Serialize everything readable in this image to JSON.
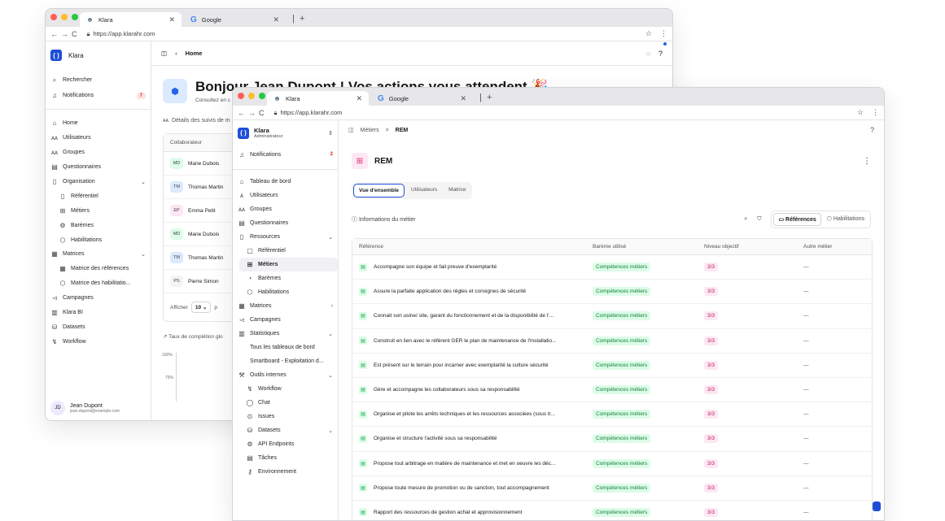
{
  "back_window": {
    "tabs": [
      {
        "title": "Klara"
      },
      {
        "title": "Google"
      }
    ],
    "url": "https://app.klarahr.com",
    "app_name": "Klara",
    "breadcrumb": "Home",
    "sidebar": {
      "top": [
        {
          "label": "Rechercher",
          "icon": "search-icon"
        },
        {
          "label": "Notifications",
          "icon": "bell-icon",
          "badge": "7"
        }
      ],
      "items": [
        {
          "label": "Home",
          "icon": "home-icon"
        },
        {
          "label": "Utilisateurs",
          "icon": "users-icon"
        },
        {
          "label": "Groupes",
          "icon": "group-icon"
        },
        {
          "label": "Questionnaires",
          "icon": "clipboard-icon"
        },
        {
          "label": "Organisation",
          "icon": "book-icon",
          "chevron": "⌄"
        },
        {
          "label": "Référentiel",
          "icon": "book-icon",
          "sub": true
        },
        {
          "label": "Métiers",
          "icon": "briefcase-icon",
          "sub": true
        },
        {
          "label": "Barèmes",
          "icon": "gear-icon",
          "sub": true
        },
        {
          "label": "Habilitations",
          "icon": "shield-icon",
          "sub": true
        },
        {
          "label": "Matrices",
          "icon": "grid-icon",
          "chevron": "⌄"
        },
        {
          "label": "Matrice des références",
          "icon": "grid-icon",
          "sub": true
        },
        {
          "label": "Matrice des habilitatio...",
          "icon": "shield-icon",
          "sub": true
        },
        {
          "label": "Campagnes",
          "icon": "megaphone-icon"
        },
        {
          "label": "Klara BI",
          "icon": "chart-icon"
        },
        {
          "label": "Datasets",
          "icon": "database-icon"
        },
        {
          "label": "Workflow",
          "icon": "workflow-icon"
        }
      ],
      "user": {
        "initials": "JD",
        "name": "Jean Dupont",
        "email": "jean.dupont@example.com"
      }
    },
    "greeting": "Bonjour Jean Dupont ! Vos actions vous attendent 🎉",
    "greeting_sub": "Consultez en c",
    "followups_title": "Détails des suivis de m",
    "table_header": "Collaborateur",
    "people": [
      {
        "initials": "MD",
        "name": "Marie Dubois",
        "color": "#dcfce7"
      },
      {
        "initials": "TM",
        "name": "Thomas Martin",
        "color": "#dbeafe"
      },
      {
        "initials": "EP",
        "name": "Emma Petit",
        "color": "#fce7f3"
      },
      {
        "initials": "MD",
        "name": "Marie Dubois",
        "color": "#dcfce7"
      },
      {
        "initials": "TM",
        "name": "Thomas Martin",
        "color": "#dbeafe"
      },
      {
        "initials": "PS",
        "name": "Pierre Simon",
        "color": "#f4f4f5"
      }
    ],
    "pager_label": "Afficher",
    "pager_value": "10",
    "pager_tail": "p",
    "completion_title": "Taux de complétion glo",
    "chart_ticks": [
      "100%",
      "75%"
    ]
  },
  "front_window": {
    "tabs": [
      {
        "title": "Klara"
      },
      {
        "title": "Google"
      }
    ],
    "url": "https://app.klarahr.com",
    "org": {
      "name": "Klara",
      "role": "Administrateur"
    },
    "notifications": {
      "label": "Notifications",
      "badge": "2"
    },
    "sidebar": [
      {
        "label": "Tableau de bord",
        "icon": "home-icon"
      },
      {
        "label": "Utilisateurs",
        "icon": "user-icon"
      },
      {
        "label": "Groupes",
        "icon": "group-icon"
      },
      {
        "label": "Questionnaires",
        "icon": "clipboard-icon"
      },
      {
        "label": "Ressources",
        "icon": "book-icon",
        "chevron": "⌄"
      },
      {
        "label": "Référentiel",
        "icon": "doc-icon",
        "sub": true
      },
      {
        "label": "Métiers",
        "icon": "briefcase-icon",
        "sub": true,
        "active": true
      },
      {
        "label": "Barèmes",
        "icon": "gauge-icon",
        "sub": true
      },
      {
        "label": "Habilitations",
        "icon": "shield-icon",
        "sub": true
      },
      {
        "label": "Matrices",
        "icon": "grid-icon",
        "chevron": "›"
      },
      {
        "label": "Campagnes",
        "icon": "megaphone-icon"
      },
      {
        "label": "Statistiques",
        "icon": "chart-icon",
        "chevron": "⌄"
      },
      {
        "label": "Tous les tableaux de bord",
        "icon": "",
        "sub": true
      },
      {
        "label": "Smartboard - Exploitation d...",
        "icon": "",
        "sub": true
      },
      {
        "label": "Outils internes",
        "icon": "wrench-icon",
        "chevron": "⌄"
      },
      {
        "label": "Workflow",
        "icon": "workflow-icon",
        "sub": true
      },
      {
        "label": "Chat",
        "icon": "chat-icon",
        "sub": true
      },
      {
        "label": "Issues",
        "icon": "issue-icon",
        "sub": true
      },
      {
        "label": "Datasets",
        "icon": "database-icon",
        "sub": true,
        "chevron": "⌄"
      },
      {
        "label": "API Endpoints",
        "icon": "gear-icon",
        "sub": true
      },
      {
        "label": "Tâches",
        "icon": "clipboard-icon",
        "sub": true
      },
      {
        "label": "Environnement",
        "icon": "key-icon",
        "sub": true
      }
    ],
    "breadcrumb": {
      "parent": "Métiers",
      "sep": ">",
      "current": "REM"
    },
    "page_title": "REM",
    "tabs_view": [
      "Vue d'ensemble",
      "Utilisateurs",
      "Matrice"
    ],
    "info_label": "Informations du métier",
    "toggle": {
      "refs": "Références",
      "habs": "Habilitations"
    },
    "columns": [
      "Référence",
      "Barème utilisé",
      "Niveau objectif",
      "Autre métier"
    ],
    "rows": [
      {
        "ref": "Accompagne son équipe et fait preuve d'exemplarité",
        "bareme": "Compétences métiers",
        "level": "3/3",
        "other": "—"
      },
      {
        "ref": "Assure la parfaite application des règles et consignes de sécurité",
        "bareme": "Compétences métiers",
        "level": "3/3",
        "other": "—"
      },
      {
        "ref": "Connait son usine/ site, garant du fonctionnement et de la disponibilité de l'...",
        "bareme": "Compétences métiers",
        "level": "3/3",
        "other": "—"
      },
      {
        "ref": "Construit en lien avec le référent GER le plan de maintenance de l'installatio...",
        "bareme": "Compétences métiers",
        "level": "3/3",
        "other": "—"
      },
      {
        "ref": "Est présent sur le terrain pour incarner avec exemplarité la culture sécurité",
        "bareme": "Compétences métiers",
        "level": "3/3",
        "other": "—"
      },
      {
        "ref": "Gère et accompagne les collaborateurs sous sa responsabilité",
        "bareme": "Compétences métiers",
        "level": "3/3",
        "other": "—"
      },
      {
        "ref": "Organise et pilote les arrêts techniques et les ressources associées (sous tr...",
        "bareme": "Compétences métiers",
        "level": "3/3",
        "other": "—"
      },
      {
        "ref": "Organise et structure l'activité sous sa responsabilité",
        "bareme": "Compétences métiers",
        "level": "3/3",
        "other": "—"
      },
      {
        "ref": "Propose tout arbitrage en matière de maintenance et met en oeuvre les déc...",
        "bareme": "Compétences métiers",
        "level": "3/3",
        "other": "—"
      },
      {
        "ref": "Propose toute mesure de promotion ou de sanction, tout accompagnement",
        "bareme": "Compétences métiers",
        "level": "3/3",
        "other": "—"
      },
      {
        "ref": "Rapport des ressources de gestion achat et approvisionnement",
        "bareme": "Compétences métiers",
        "level": "3/3",
        "other": "—"
      }
    ]
  }
}
